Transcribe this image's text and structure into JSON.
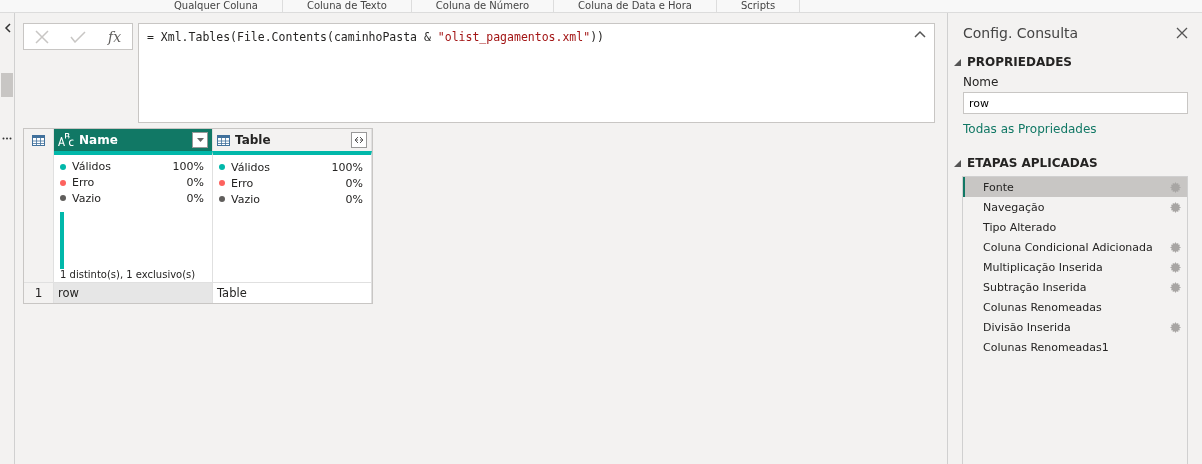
{
  "ribbon_groups": [
    "Qualquer Coluna",
    "Coluna de Texto",
    "Coluna de Número",
    "Coluna de Data e Hora",
    "Scripts"
  ],
  "formula_bar": {
    "parts": [
      {
        "kind": "code",
        "text": "= Xml.Tables(File.Contents(caminhoPasta & "
      },
      {
        "kind": "string",
        "text": "\"olist_pagamentos.xml\""
      },
      {
        "kind": "code",
        "text": "))"
      }
    ],
    "fx": "fx"
  },
  "table": {
    "columns": [
      {
        "name": "Name",
        "kind": "text",
        "selected": true,
        "quality": [
          {
            "label": "Válidos",
            "value": "100%",
            "color": "#01b8aa"
          },
          {
            "label": "Erro",
            "value": "0%",
            "color": "#fd625e"
          },
          {
            "label": "Vazio",
            "value": "0%",
            "color": "#605e5c"
          }
        ],
        "distribution": "1 distinto(s), 1 exclusivo(s)"
      },
      {
        "name": "Table",
        "kind": "table",
        "selected": false,
        "quality": [
          {
            "label": "Válidos",
            "value": "100%",
            "color": "#01b8aa"
          },
          {
            "label": "Erro",
            "value": "0%",
            "color": "#fd625e"
          },
          {
            "label": "Vazio",
            "value": "0%",
            "color": "#605e5c"
          }
        ]
      }
    ],
    "rows": [
      {
        "number": "1",
        "cells": [
          "row",
          "Table"
        ]
      }
    ]
  },
  "query_settings": {
    "title": "Config. Consulta",
    "properties_heading": "PROPRIEDADES",
    "name_label": "Nome",
    "name_value": "row",
    "all_properties": "Todas as Propriedades",
    "steps_heading": "ETAPAS APLICADAS",
    "steps": [
      {
        "label": "Fonte",
        "selected": true,
        "gear": true
      },
      {
        "label": "Navegação",
        "selected": false,
        "gear": true
      },
      {
        "label": "Tipo Alterado",
        "selected": false,
        "gear": false
      },
      {
        "label": "Coluna Condicional Adicionada",
        "selected": false,
        "gear": true
      },
      {
        "label": "Multiplicação Inserida",
        "selected": false,
        "gear": true
      },
      {
        "label": "Subtração Inserida",
        "selected": false,
        "gear": true
      },
      {
        "label": "Colunas Renomeadas",
        "selected": false,
        "gear": false
      },
      {
        "label": "Divisão Inserida",
        "selected": false,
        "gear": true
      },
      {
        "label": "Colunas Renomeadas1",
        "selected": false,
        "gear": false
      }
    ]
  }
}
